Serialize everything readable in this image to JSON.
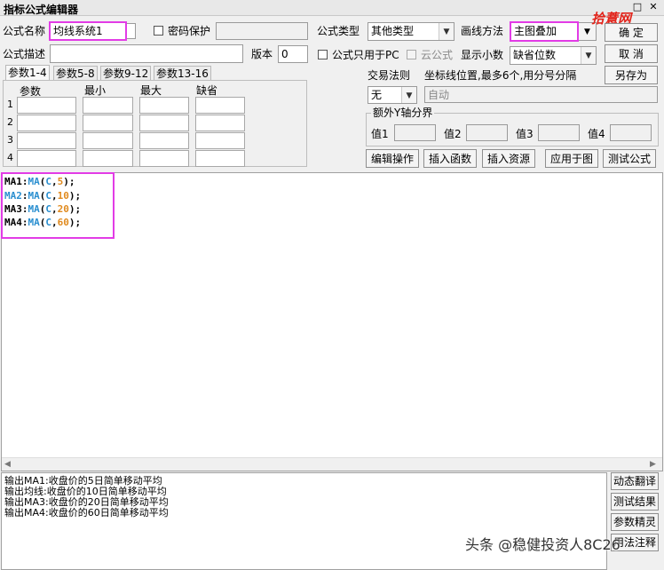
{
  "window": {
    "title": "指标公式编辑器",
    "controls": [
      "□",
      "✕"
    ]
  },
  "watermark_top": "拾薏网",
  "form": {
    "name_label": "公式名称",
    "name_value": "均线系统1",
    "password_label": "密码保护",
    "type_label": "公式类型",
    "type_value": "其他类型",
    "draw_label": "画线方法",
    "draw_value": "主图叠加",
    "desc_label": "公式描述",
    "desc_value": "",
    "version_label": "版本",
    "version_value": "0",
    "pc_only_label": "公式只用于PC",
    "cloud_label": "云公式",
    "decimals_label": "显示小数",
    "decimals_value": "缺省位数",
    "trade_rule_label": "交易法则",
    "trade_rule_value": "无",
    "coord_label": "坐标线位置,最多6个,用分号分隔",
    "coord_value": "自动",
    "extra_y_label": "额外Y轴分界",
    "extra_y_values": [
      "值1",
      "值2",
      "值3",
      "值4"
    ]
  },
  "buttons": {
    "ok": "确  定",
    "cancel": "取  消",
    "save_as": "另存为",
    "edit_ops": "编辑操作",
    "insert_func": "插入函数",
    "insert_res": "插入资源",
    "apply_chart": "应用于图",
    "test": "测试公式"
  },
  "param_tabs": [
    "参数1-4",
    "参数5-8",
    "参数9-12",
    "参数13-16"
  ],
  "param_headers": [
    "参数",
    "最小",
    "最大",
    "缺省"
  ],
  "param_rows": [
    "1",
    "2",
    "3",
    "4"
  ],
  "code_lines": [
    {
      "name": "MA1",
      "func": "MA",
      "arg": "C",
      "period": "5"
    },
    {
      "name": "MA2",
      "func": "MA",
      "arg": "C",
      "period": "10"
    },
    {
      "name": "MA3",
      "func": "MA",
      "arg": "C",
      "period": "20"
    },
    {
      "name": "MA4",
      "func": "MA",
      "arg": "C",
      "period": "60"
    }
  ],
  "output_lines": [
    "输出MA1:收盘价的5日简单移动平均",
    "输出均线:收盘价的10日简单移动平均",
    "输出MA3:收盘价的20日简单移动平均",
    "输出MA4:收盘价的60日简单移动平均"
  ],
  "side_buttons": [
    "动态翻译",
    "测试结果",
    "参数精灵",
    "用法注释"
  ],
  "watermark_bottom": "头条 @稳健投资人8C26"
}
